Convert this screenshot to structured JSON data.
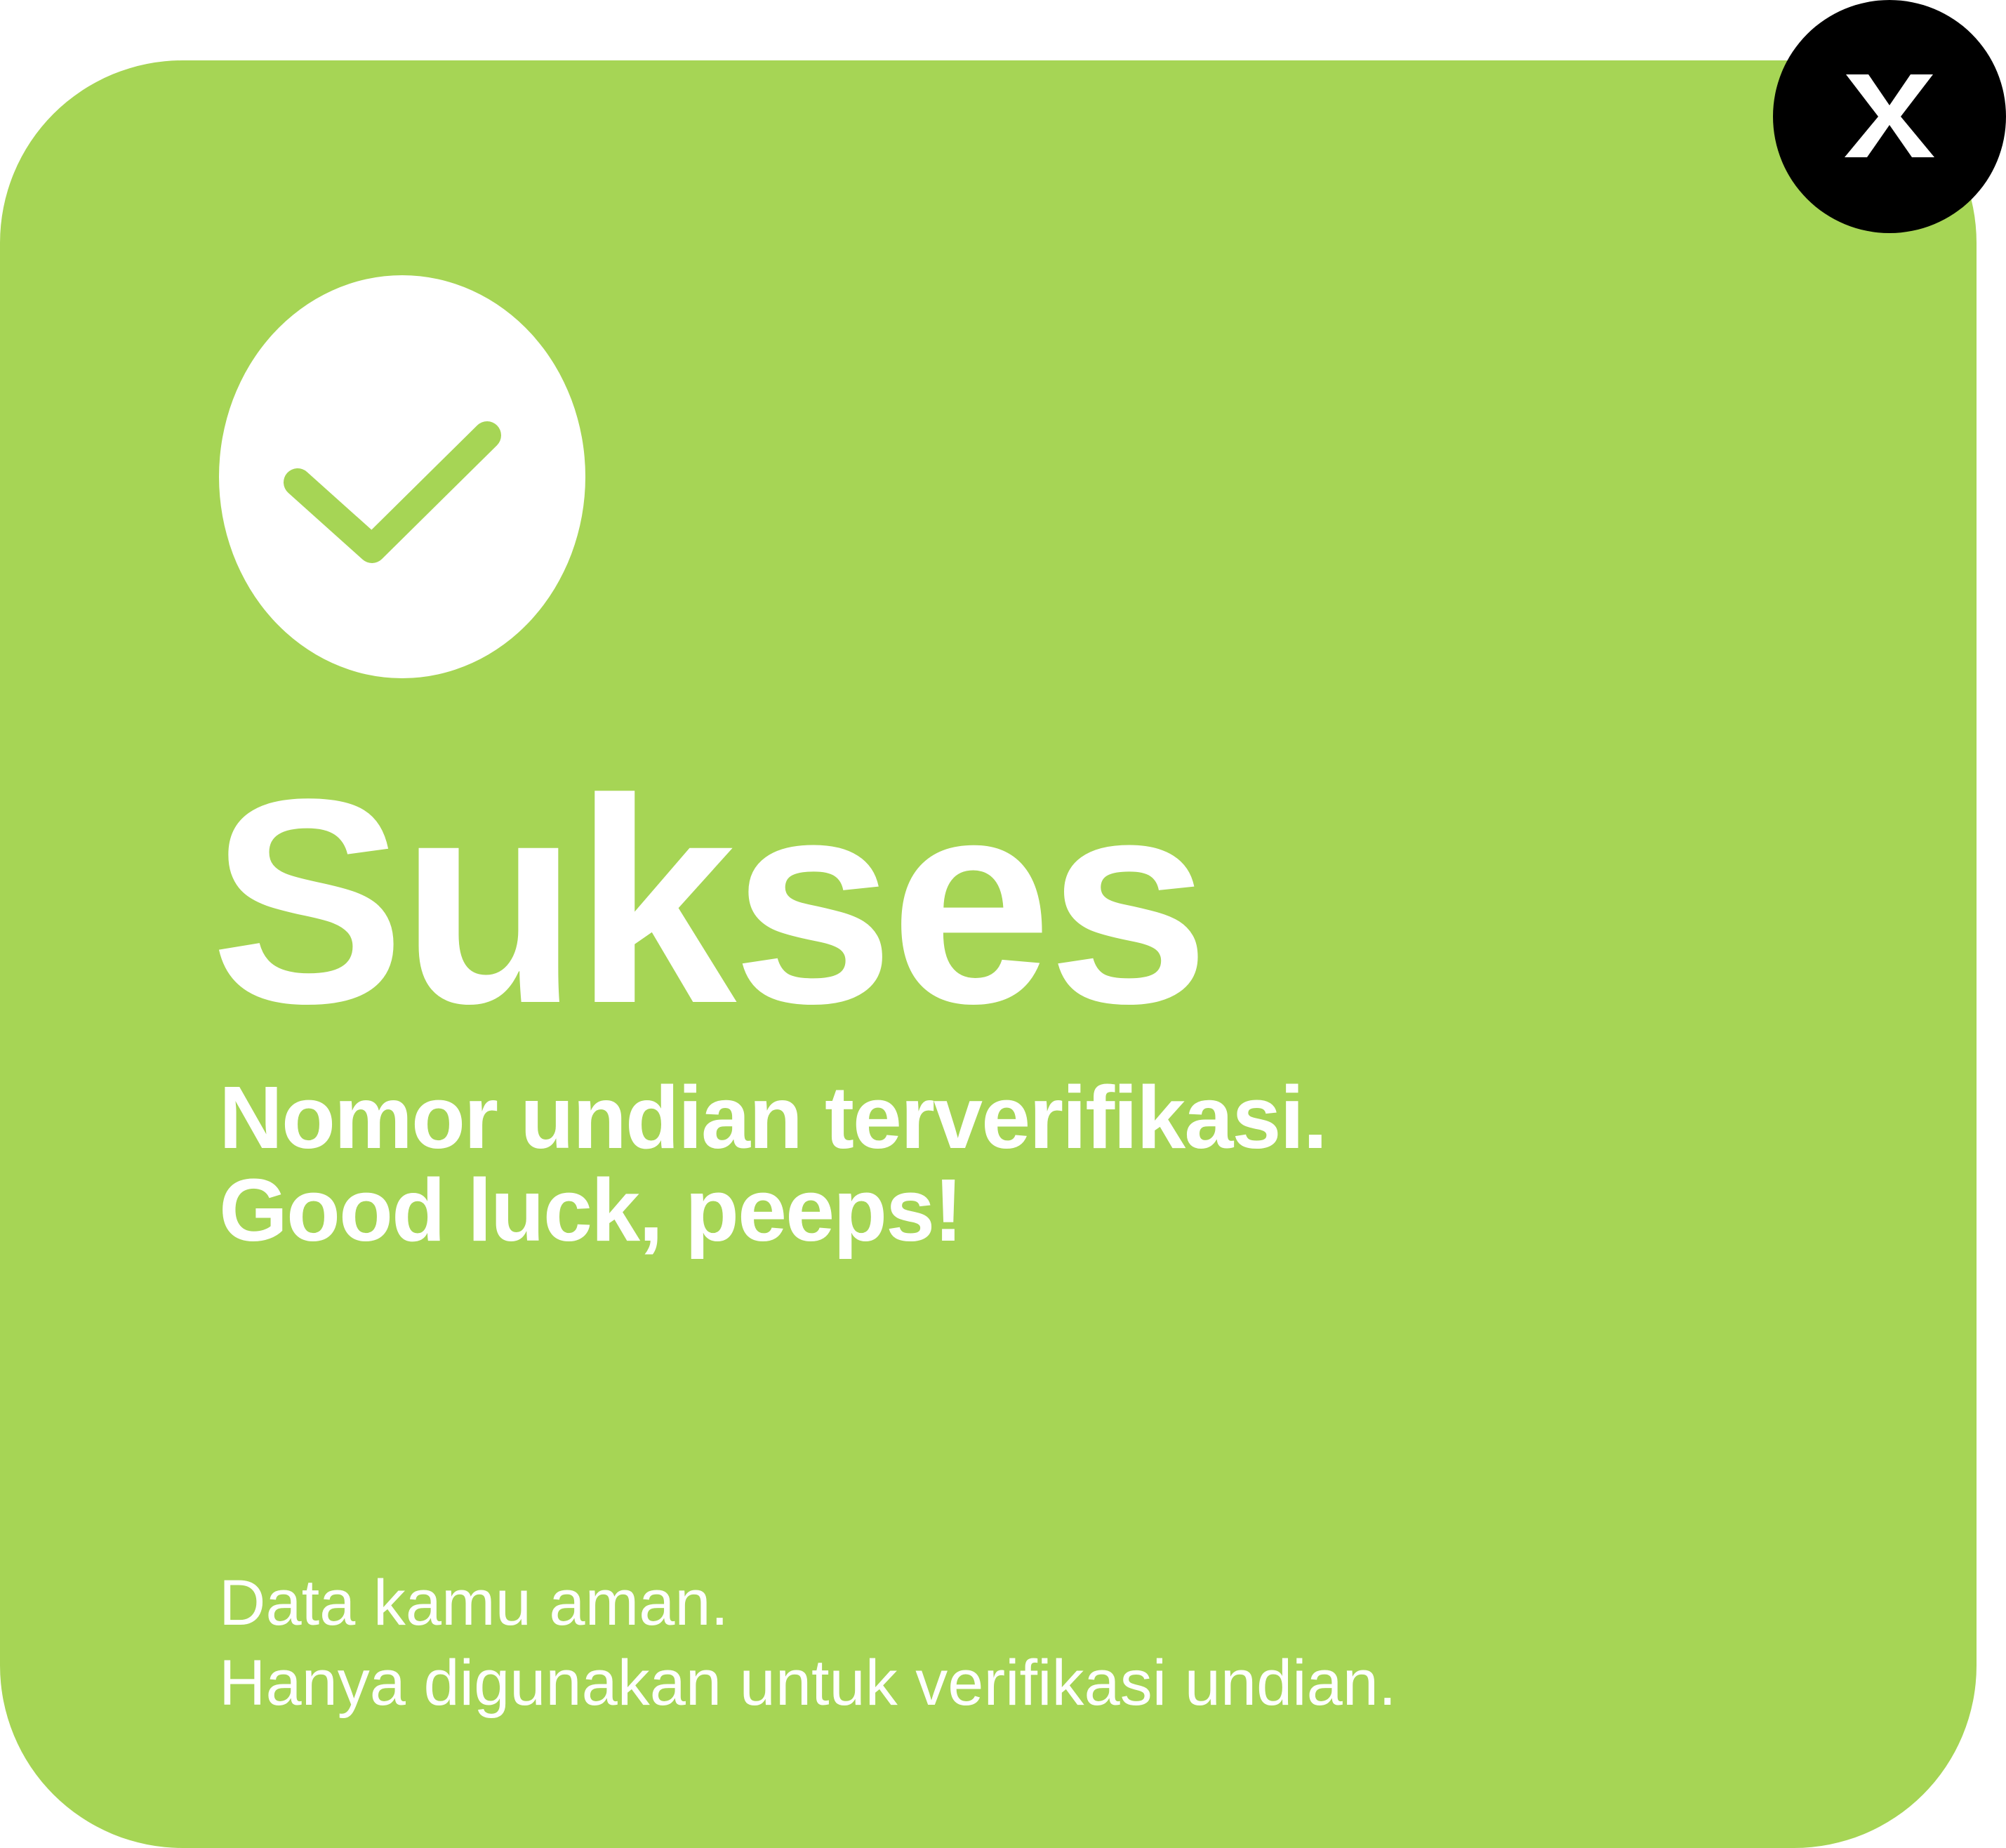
{
  "dialog": {
    "status_icon": "check-circle-icon",
    "title": "Sukses",
    "message_lines": [
      "Nomor undian terverifikasi.",
      "Good luck, peeps!"
    ],
    "privacy_lines": [
      "Data kamu aman.",
      "Hanya digunakan untuk verifikasi undian."
    ],
    "close_icon": "close-icon",
    "close_label": "X"
  },
  "colors": {
    "card_background": "#a6d555",
    "text": "#ffffff",
    "close_background": "#000000",
    "page_background": "#ffffff"
  }
}
